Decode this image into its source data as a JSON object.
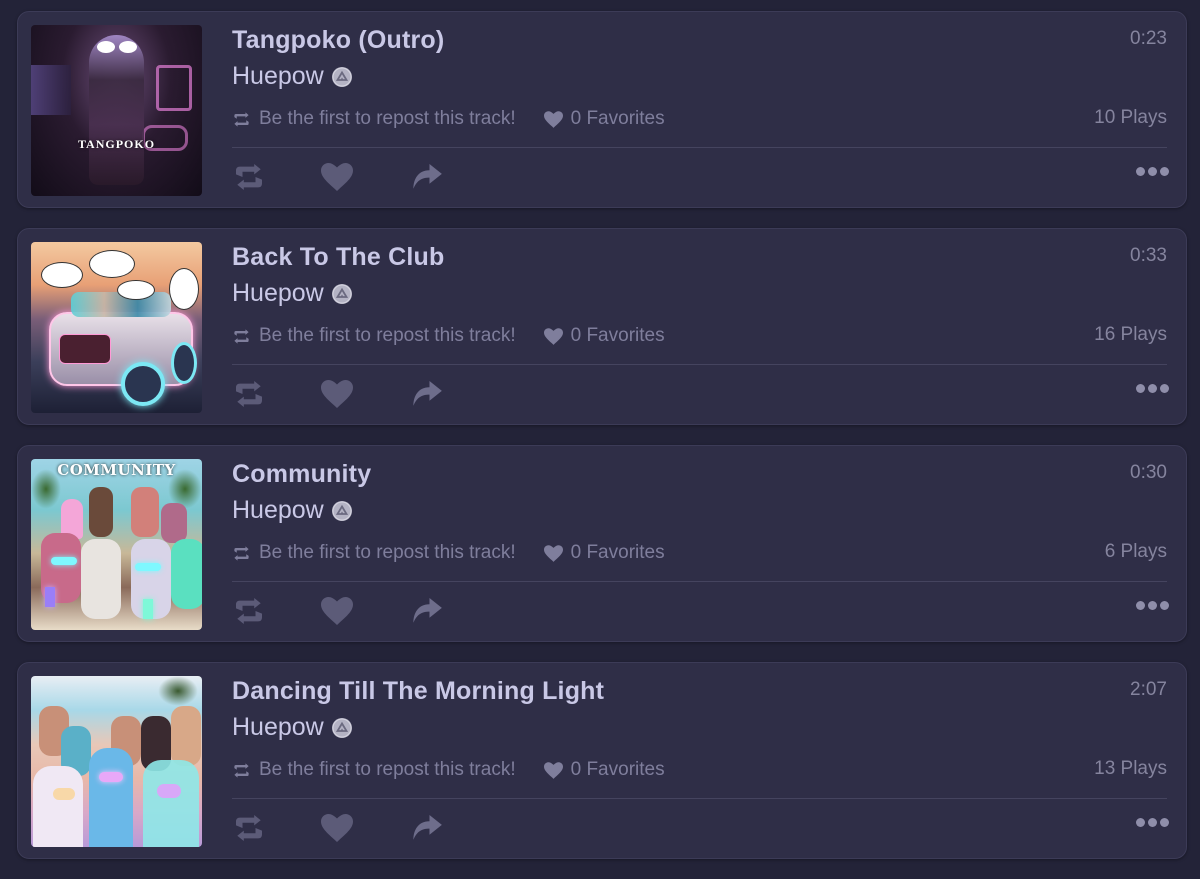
{
  "colors": {
    "page_bg": "#232338",
    "card_bg": "#2f2e47",
    "title_text": "#c9c8e6",
    "muted_text": "#7f7e9c",
    "icon": "#6e6d8b"
  },
  "tracks": [
    {
      "title": "Tangpoko (Outro)",
      "artist": "Huepow",
      "artist_badge": "verified-badge-icon",
      "duration": "0:23",
      "repost_text": "Be the first to repost this track!",
      "favorites_text": "0 Favorites",
      "plays_text": "10 Plays",
      "artwork_text": "Tangpoko",
      "artwork_description": "character in sunglasses with neon signs"
    },
    {
      "title": "Back To The Club",
      "artist": "Huepow",
      "artist_badge": "verified-badge-icon",
      "duration": "0:33",
      "repost_text": "Be the first to repost this track!",
      "favorites_text": "0 Favorites",
      "plays_text": "16 Plays",
      "artwork_text": "",
      "artwork_description": "futuristic glowing car at sunset with speech bubbles"
    },
    {
      "title": "Community",
      "artist": "Huepow",
      "artist_badge": "verified-badge-icon",
      "duration": "0:30",
      "repost_text": "Be the first to repost this track!",
      "favorites_text": "0 Favorites",
      "plays_text": "6 Plays",
      "artwork_text": "Community",
      "artwork_description": "group of characters on a beach with glowing drinks"
    },
    {
      "title": "Dancing Till The Morning Light",
      "artist": "Huepow",
      "artist_badge": "verified-badge-icon",
      "duration": "2:07",
      "repost_text": "Be the first to repost this track!",
      "favorites_text": "0 Favorites",
      "plays_text": "13 Plays",
      "artwork_text": "",
      "artwork_description": "beach party crowd in pastel colors"
    }
  ]
}
